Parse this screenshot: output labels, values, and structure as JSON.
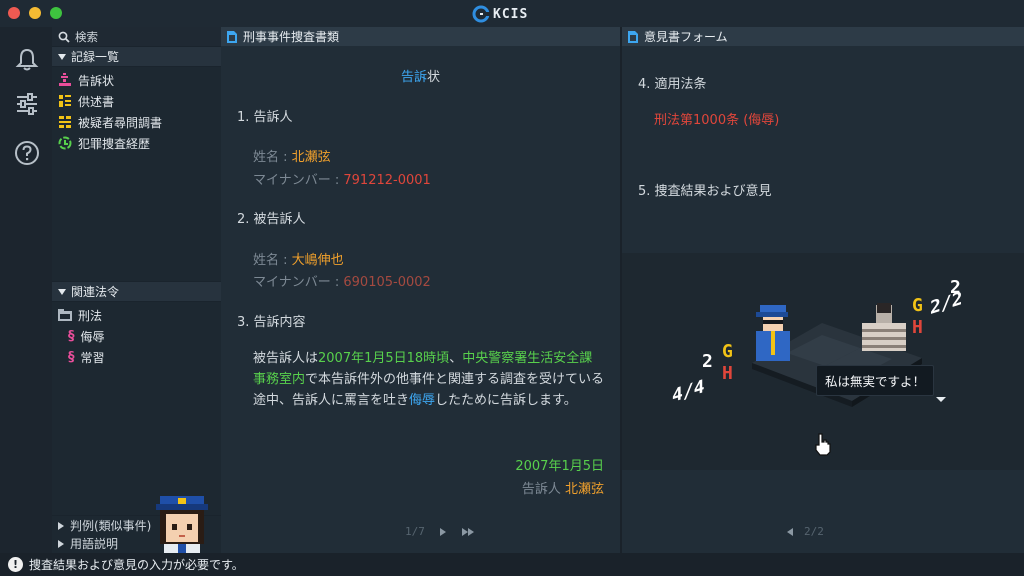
{
  "window": {
    "title": "KCIS"
  },
  "sidebar": {
    "search_label": "検索",
    "records_heading": "記録一覧",
    "records": [
      {
        "label": "告訴状",
        "icon": "complaint-icon",
        "color": "#e84e9a"
      },
      {
        "label": "供述書",
        "icon": "statement-icon",
        "color": "#f2c316"
      },
      {
        "label": "被疑者尋問調書",
        "icon": "interrogation-icon",
        "color": "#f2c316"
      },
      {
        "label": "犯罪捜査経歴",
        "icon": "history-icon",
        "color": "#58d04c"
      }
    ],
    "laws_heading": "関連法令",
    "laws": [
      {
        "label": "刑法",
        "icon": "folder-icon",
        "indent": 0
      },
      {
        "label": "侮辱",
        "icon": "section-icon",
        "indent": 1
      },
      {
        "label": "常習",
        "icon": "section-icon",
        "indent": 1
      }
    ],
    "bottom_items": [
      {
        "label": "判例(類似事件)"
      },
      {
        "label": "用語説明"
      }
    ]
  },
  "document": {
    "panel_title": "刑事事件捜査書類",
    "title_highlight": "告訴",
    "title_rest": "状",
    "sec1_heading": "1. 告訴人",
    "complainant_name_label": "姓名 : ",
    "complainant_name": "北瀬弦",
    "complainant_id_label": "マイナンバー : ",
    "complainant_id": "791212-0001",
    "sec2_heading": "2. 被告訴人",
    "accused_name_label": "姓名 : ",
    "accused_name": "大嶋伸也",
    "accused_id_label": "マイナンバー : ",
    "accused_id": "690105-0002",
    "sec3_heading": "3. 告訴内容",
    "body": {
      "p1": "被告訴人は",
      "date_time": "2007年1月5日18時頃",
      "p2": "、",
      "place": "中央警察署生活安全課事務室内",
      "p3": "で本告訴件外の他事件と関連する調査を受けている途中、告訴人に罵言を吐き",
      "insult": "侮辱",
      "p4": "したために告訴します。"
    },
    "sign_date": "2007年1月5日",
    "sign_label": "告訴人 ",
    "sign_name": "北瀬弦",
    "page": "1/7"
  },
  "opinion": {
    "panel_title": "意見書フォーム",
    "sec4_heading": "4. 適用法条",
    "law_applied": "刑法第1000条 (侮辱)",
    "sec5_heading": "5. 捜査結果および意見",
    "page": "2/2"
  },
  "scene": {
    "speech": "私は無実ですよ！",
    "left_stats": {
      "g": "G",
      "h": "H",
      "top": "2",
      "bottom": "4/4"
    },
    "right_stats": {
      "g": "G",
      "h": "H",
      "top": "2",
      "bottom": "2/2"
    }
  },
  "status": {
    "message": "捜査結果および意見の入力が必要です。"
  }
}
